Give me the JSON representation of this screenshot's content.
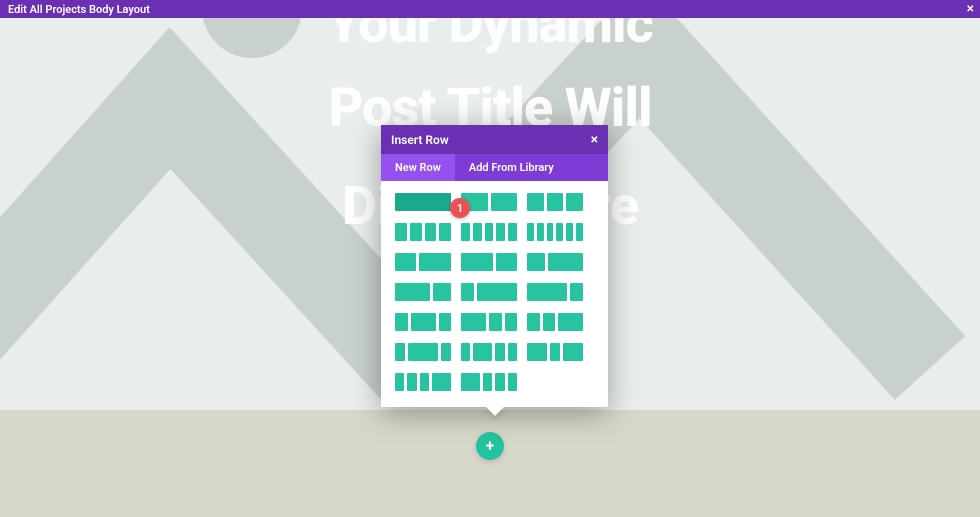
{
  "topbar": {
    "title": "Edit All Projects Body Layout",
    "close": "×"
  },
  "hero": {
    "line1": "Your Dynamic",
    "line2": "Post Title Will",
    "line3": "Display Here"
  },
  "modal": {
    "title": "Insert Row",
    "close": "×",
    "tabs": {
      "new_row": "New Row",
      "add_from_library": "Add From Library"
    }
  },
  "add_button": {
    "glyph": "+"
  },
  "markers": {
    "m1": "1"
  }
}
